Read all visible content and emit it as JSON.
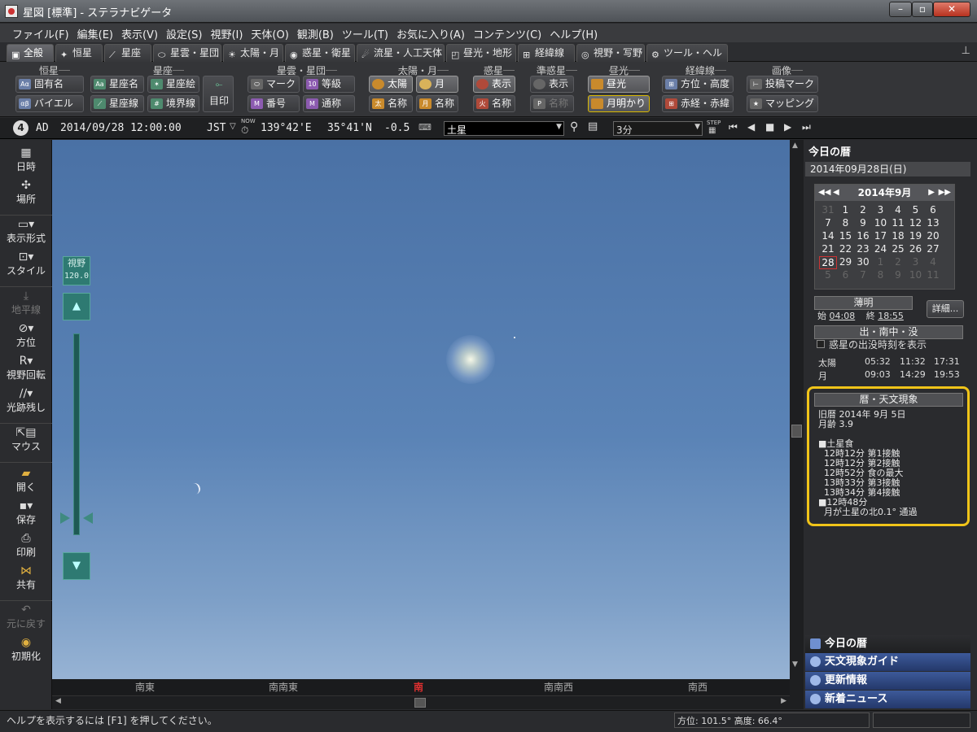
{
  "window": {
    "title": "星図 [標準] - ステラナビゲータ"
  },
  "menu": [
    "ファイル(F)",
    "編集(E)",
    "表示(V)",
    "設定(S)",
    "視野(I)",
    "天体(O)",
    "観測(B)",
    "ツール(T)",
    "お気に入り(A)",
    "コンテンツ(C)",
    "ヘルプ(H)"
  ],
  "tabs": [
    "全般",
    "恒星",
    "星座",
    "星雲・星団",
    "太陽・月",
    "惑星・衛星",
    "流星・人工天体",
    "昼光・地形",
    "経緯線",
    "視野・写野",
    "ツール・ヘルプ"
  ],
  "ribbon": {
    "groups": [
      "恒星",
      "星座",
      "星雲・星団",
      "太陽・月",
      "惑星",
      "準惑星",
      "昼光",
      "経緯線",
      "画像"
    ],
    "buttons": {
      "proper_name": "固有名",
      "bayer": "バイエル",
      "const_name": "星座名",
      "const_pic": "星座絵",
      "const_line": "星座線",
      "boundary": "境界線",
      "mejirushi": "目印",
      "mark": "マーク",
      "magnitude": "等級",
      "number": "番号",
      "common_name": "通称",
      "sun": "太陽",
      "moon": "月",
      "sun_name": "名称",
      "moon_name": "名称",
      "planet_show": "表示",
      "planet_name": "名称",
      "dwarf_show": "表示",
      "dwarf_name": "名称",
      "daylight": "昼光",
      "moonlight": "月明かり",
      "azalt": "方位・高度",
      "radec": "赤経・赤緯",
      "post_mark": "投稿マーク",
      "mapping": "マッピング"
    }
  },
  "status_row": {
    "era": "AD",
    "datetime": "2014/09/28 12:00:00",
    "tz": "JST",
    "now": "NOW",
    "longitude": "139°42'E",
    "latitude": "35°41'N",
    "altitude": "-0.5",
    "object_search": "土星",
    "step": "3分",
    "step_label": "STEP"
  },
  "left_toolbar": [
    "日時",
    "場所",
    "表示形式",
    "スタイル",
    "地平線",
    "方位",
    "視野回転",
    "光跡残し",
    "マウス",
    "開く",
    "保存",
    "印刷",
    "共有",
    "元に戻す",
    "初期化"
  ],
  "fov": {
    "label": "視野",
    "value": "120.0"
  },
  "compass": [
    "南東",
    "南南東",
    "南",
    "南南西",
    "南西"
  ],
  "right_panel": {
    "header": "今日の暦",
    "date": "2014年09月28日(日)",
    "calendar": {
      "month": "2014年9月",
      "days": [
        [
          "31",
          "1",
          "2",
          "3",
          "4",
          "5",
          "6"
        ],
        [
          "7",
          "8",
          "9",
          "10",
          "11",
          "12",
          "13"
        ],
        [
          "14",
          "15",
          "16",
          "17",
          "18",
          "19",
          "20"
        ],
        [
          "21",
          "22",
          "23",
          "24",
          "25",
          "26",
          "27"
        ],
        [
          "28",
          "29",
          "30",
          "1",
          "2",
          "3",
          "4"
        ],
        [
          "5",
          "6",
          "7",
          "8",
          "9",
          "10",
          "11"
        ]
      ]
    },
    "twilight": {
      "title": "薄明",
      "start_label": "始",
      "start": "04:08",
      "end_label": "終",
      "end": "18:55",
      "detail_btn": "詳細..."
    },
    "rise_set": {
      "title": "出・南中・没",
      "checkbox": "惑星の出没時刻を表示",
      "rows": [
        {
          "name": "太陽",
          "rise": "05:32",
          "transit": "11:32",
          "set": "17:31"
        },
        {
          "name": "月",
          "rise": "09:03",
          "transit": "14:29",
          "set": "19:53"
        }
      ]
    },
    "phenomena": {
      "title": "暦・天文現象",
      "lines": [
        "旧暦 2014年 9月 5日",
        "月齢 3.9",
        "",
        "■土星食",
        "  12時12分 第1接触",
        "  12時12分 第2接触",
        "  12時52分 食の最大",
        "  13時33分 第3接触",
        "  13時34分 第4接触",
        "■12時48分",
        "  月が土星の北0.1° 通過"
      ]
    },
    "nav": [
      "今日の暦",
      "天文現象ガイド",
      "更新情報",
      "新着ニュース"
    ]
  },
  "statusbar": {
    "help": "ヘルプを表示するには [F1] を押してください。",
    "position": "方位: 101.5° 高度: 66.4°"
  },
  "colors": {
    "accent": "#f0c419",
    "sky_top": "#4a71a5",
    "sky_bottom": "#97b3d4",
    "nav_blue": "#2f4c86"
  }
}
